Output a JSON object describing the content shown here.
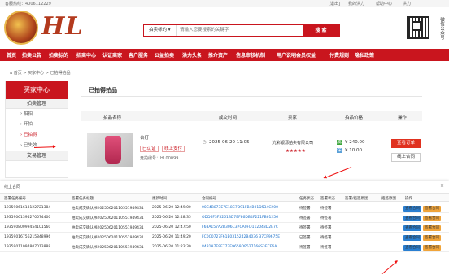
{
  "topbar": {
    "hotline": "客服热线：4006112229",
    "links": [
      "[退出]",
      "我的洪力",
      "帮助中心",
      "洪力"
    ]
  },
  "logo": {
    "text": "HL"
  },
  "search": {
    "select_value": "拍卖标的",
    "placeholder": "请输入您要搜索的关键字",
    "button": "搜 索"
  },
  "qr_caption": "微信公众号",
  "nav": {
    "items": [
      "首页",
      "拍卖公告",
      "拍卖标的",
      "招商中心",
      "认证商家",
      "客户服务",
      "公益拍卖",
      "洪力头条",
      "推介资产",
      "信息审核机制",
      "用户说明会员权益",
      "付费规则",
      "隐私政策"
    ]
  },
  "breadcrumb": "首页 > 买家中心 > 已拍得拍品",
  "sidebar": {
    "title": "买家中心",
    "group1": "拍卖管理",
    "items": [
      "拍拍",
      "开拍",
      "已拍得",
      "已失效"
    ],
    "group2": "交易管理"
  },
  "main": {
    "title": "已拍得拍品",
    "columns": [
      "拍品名称",
      "成交时间",
      "卖家",
      "拍品价格",
      "操作"
    ],
    "row": {
      "name": "台灯",
      "tags": [
        "已认证",
        "线上支付"
      ],
      "code": "竞拍编号：HL00099",
      "time": "2025-06-20 11:05",
      "seller": "光彩银源拍卖有限公司",
      "stars": "★★★★★",
      "price_badge": "成",
      "price": "¥ 240.00",
      "deposit_badge": "保",
      "deposit": "¥ 10.00",
      "btn_order": "查看订单",
      "btn_contract": "线上合同"
    }
  },
  "overlay": {
    "title": "线上合同",
    "close": "×",
    "columns": [
      "签署任务编号",
      "签署任务标题",
      "更新时间",
      "合同编号",
      "任务状态",
      "签署状态",
      "签署/拒签原因",
      "拒签原因",
      "操作"
    ],
    "rows": [
      {
        "id": "19359061613122721384",
        "title": "拍卖成交确认书20250620110551949431",
        "time": "2025-06-20 12:49:00",
        "contract": "00C4B873E7E18C7D91FB4B01D534C200",
        "task": "待签署",
        "status": "待签署",
        "reason": "",
        "refuse": ""
      },
      {
        "id": "19359061395270574400",
        "title": "拍卖成交确认书20250620110551949431",
        "time": "2025-06-20 12:48:35",
        "contract": "ODD6F3F5261BD7EF86DB4F221FB61256",
        "task": "待签署",
        "status": "待签署",
        "reason": "",
        "refuse": ""
      },
      {
        "id": "19359080099454101560",
        "title": "拍卖成交确认书20250620110551949431",
        "time": "2025-06-20 12:47:50",
        "contract": "F68A157A2B306C37CA0FD112048D2E7C",
        "task": "待签署",
        "status": "待签署",
        "reason": "",
        "refuse": ""
      },
      {
        "id": "19359016756215848996",
        "title": "拍卖成交确认书20250620110551949431",
        "time": "2025-06-20 11:49:20",
        "contract": "FC0C0727F61E0315242B4036 37CF9675E",
        "task": "已签署",
        "status": "待签署",
        "reason": "",
        "refuse": ""
      },
      {
        "id": "19359011094807013888",
        "title": "拍卖成交确认书20250620110551949431",
        "time": "2025-06-20 11:23:30",
        "contract": "8481A7E9F773E9659D9527166S3ECF6A",
        "task": "待签署",
        "status": "待签署",
        "reason": "",
        "refuse": ""
      }
    ],
    "btn_view": "查看合同",
    "btn_sign": "签署合同"
  },
  "colors": {
    "brand_red": "#c9151e",
    "link_blue": "#1a6fc9"
  }
}
